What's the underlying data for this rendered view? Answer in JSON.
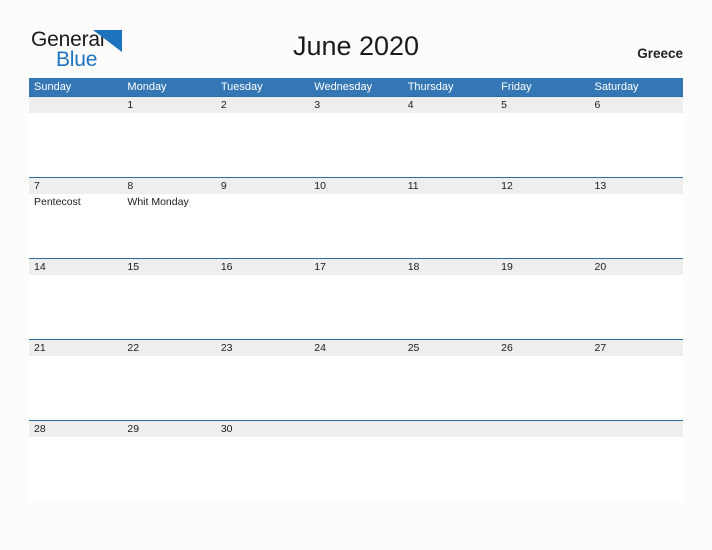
{
  "brand": {
    "name_part1": "General",
    "name_part2": "Blue",
    "triangle_color": "#1e73be",
    "logo_icon": "triangle-flag-icon"
  },
  "header": {
    "title": "June 2020",
    "country": "Greece"
  },
  "colors": {
    "header_blue": "#3577b5",
    "row_divider_blue": "#2e6da4",
    "band_gray": "#eeeeee",
    "page_background": "#fcfcfd",
    "text": "#1b1b1b",
    "header_text": "#ffffff"
  },
  "calendar": {
    "month": "June",
    "year": "2020",
    "weekday_headers": [
      "Sunday",
      "Monday",
      "Tuesday",
      "Wednesday",
      "Thursday",
      "Friday",
      "Saturday"
    ],
    "weeks": [
      [
        {
          "date": "",
          "event": ""
        },
        {
          "date": "1",
          "event": ""
        },
        {
          "date": "2",
          "event": ""
        },
        {
          "date": "3",
          "event": ""
        },
        {
          "date": "4",
          "event": ""
        },
        {
          "date": "5",
          "event": ""
        },
        {
          "date": "6",
          "event": ""
        }
      ],
      [
        {
          "date": "7",
          "event": "Pentecost"
        },
        {
          "date": "8",
          "event": "Whit Monday"
        },
        {
          "date": "9",
          "event": ""
        },
        {
          "date": "10",
          "event": ""
        },
        {
          "date": "11",
          "event": ""
        },
        {
          "date": "12",
          "event": ""
        },
        {
          "date": "13",
          "event": ""
        }
      ],
      [
        {
          "date": "14",
          "event": ""
        },
        {
          "date": "15",
          "event": ""
        },
        {
          "date": "16",
          "event": ""
        },
        {
          "date": "17",
          "event": ""
        },
        {
          "date": "18",
          "event": ""
        },
        {
          "date": "19",
          "event": ""
        },
        {
          "date": "20",
          "event": ""
        }
      ],
      [
        {
          "date": "21",
          "event": ""
        },
        {
          "date": "22",
          "event": ""
        },
        {
          "date": "23",
          "event": ""
        },
        {
          "date": "24",
          "event": ""
        },
        {
          "date": "25",
          "event": ""
        },
        {
          "date": "26",
          "event": ""
        },
        {
          "date": "27",
          "event": ""
        }
      ],
      [
        {
          "date": "28",
          "event": ""
        },
        {
          "date": "29",
          "event": ""
        },
        {
          "date": "30",
          "event": ""
        },
        {
          "date": "",
          "event": ""
        },
        {
          "date": "",
          "event": ""
        },
        {
          "date": "",
          "event": ""
        },
        {
          "date": "",
          "event": ""
        }
      ]
    ]
  }
}
